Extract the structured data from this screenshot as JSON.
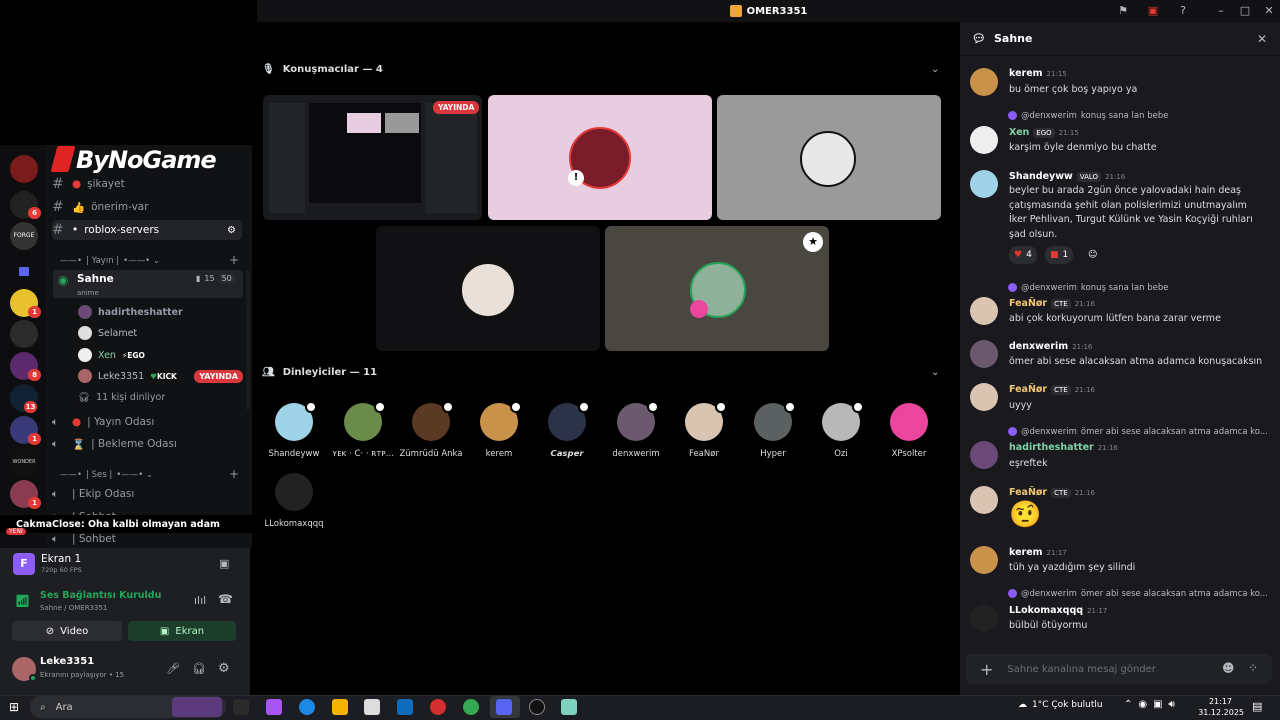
{
  "window": {
    "title": "OMER3351"
  },
  "server": {
    "banner": "ByNoGame"
  },
  "channels": [
    {
      "name": "şikayet"
    },
    {
      "name": "önerim-var"
    },
    {
      "name": "roblox-servers"
    }
  ],
  "category_yayin": "| Yayın |",
  "stage_channel": {
    "name": "Sahne",
    "topic": "anime",
    "video_count": "15",
    "member_count": "50"
  },
  "stage_members": [
    {
      "name": "hadirtheshatter"
    },
    {
      "name": "Selamet"
    },
    {
      "name": "Xen",
      "tag": "EGO"
    },
    {
      "name": "Leke3351",
      "tag": "KICK",
      "live": "YAYINDA"
    }
  ],
  "listeners_count": "11 kişi dinliyor",
  "voice_channels_1": [
    "| Yayın Odası",
    "| Bekleme Odası"
  ],
  "category_ses": "| Ses |",
  "voice_channels_2": [
    "| Ekip Odası",
    "| Sohbet",
    "| Sohbet"
  ],
  "toast": {
    "user": "CakmaClose",
    "text": " : Oha kalbi olmayan adam",
    "badge": "YENİ"
  },
  "screen": {
    "title": "Ekran 1",
    "quality": "720p 60 FPS"
  },
  "voice_status": {
    "title": "Ses Bağlantısı Kuruldu",
    "sub": "Sahne / OMER3351",
    "video_label": "Video",
    "screen_label": "Ekran"
  },
  "user": {
    "name": "Leke3351",
    "status": "Ekranını paylaşıyor • 15"
  },
  "speakers_header": "Konuşmacılar — 4",
  "live_badge": "YAYINDA",
  "listeners_header": "Dinleyiciler — 11",
  "listeners": [
    {
      "name": "Shandeyww",
      "color": "#9fd3e8"
    },
    {
      "name": "ʏᴇᴋ · Ϲ· · ʀᴛᴘ...",
      "color": "#6a8b4a"
    },
    {
      "name": "Zümrüdü Anka",
      "color": "#5a3a22"
    },
    {
      "name": "kerem",
      "color": "#c9924a"
    },
    {
      "name": "𝘾𝙖𝙨𝙥𝙚𝙧",
      "color": "#2c3348"
    },
    {
      "name": "denxwerim",
      "color": "#6b5a6e"
    },
    {
      "name": "FeaÑør",
      "color": "#d9c4b2"
    },
    {
      "name": "Hyper",
      "color": "#5b6060"
    },
    {
      "name": "Ozi",
      "color": "#b8b8b8"
    },
    {
      "name": "XPsolter",
      "color": "#eb459e"
    },
    {
      "name": "LLokomaxqqq",
      "color": "#222222"
    }
  ],
  "chat": {
    "title": "Sahne",
    "input_placeholder": "Sahne kanalına mesaj gönder",
    "messages": [
      {
        "name": "kerem",
        "time": "21:15",
        "text": "bu ömer çok boş yapıyo ya"
      },
      {
        "reply_user": "@denxwerim",
        "reply_text": "konuş sana lan bebe",
        "name": "Xen",
        "tag": "EGO",
        "time": "21:15",
        "text": "karşim öyle denmiyo bu chatte"
      },
      {
        "name": "Shandeyww",
        "tag": "VALO",
        "time": "21:16",
        "text": "beyler bu arada 2gün önce yalovadaki hain deaş çatışmasında şehit olan polislerimizi unutmayalım İker Pehlivan, Turgut Külünk ve Yasin Koçyiği ruhları şad olsun.",
        "reactions": [
          "4",
          "1"
        ]
      },
      {
        "reply_user": "@denxwerim",
        "reply_text": "konuş sana lan bebe",
        "name": "FeaÑør",
        "tag": "CTE",
        "time": "21:16",
        "text": "abi çok korkuyorum lütfen bana zarar verme"
      },
      {
        "name": "denxwerim",
        "time": "21:16",
        "text": "ömer abi sese alacaksan atma adamca konuşacaksın"
      },
      {
        "name": "FeaÑør",
        "tag": "CTE",
        "time": "21:16",
        "text": "uyyy"
      },
      {
        "reply_user": "@denxwerim",
        "reply_text": "ömer abi sese alacaksan atma adamca ko...",
        "name": "hadirtheshatter",
        "time": "21:16",
        "text": "eşreftek"
      },
      {
        "name": "FeaÑør",
        "tag": "CTE",
        "time": "21:16",
        "text": "🤨"
      },
      {
        "name": "kerem",
        "time": "21:17",
        "text": "tüh ya yazdığım şey silindi"
      },
      {
        "reply_user": "@denxwerim",
        "reply_text": "ömer abi sese alacaksan atma adamca ko...",
        "name": "LLokomaxqqq",
        "time": "21:17",
        "text": "bülbül ötüyormu"
      }
    ]
  },
  "taskbar": {
    "search": "Ara",
    "weather": "1°C  Çok bulutlu",
    "time": "21:17",
    "date": "31.12.2025"
  }
}
